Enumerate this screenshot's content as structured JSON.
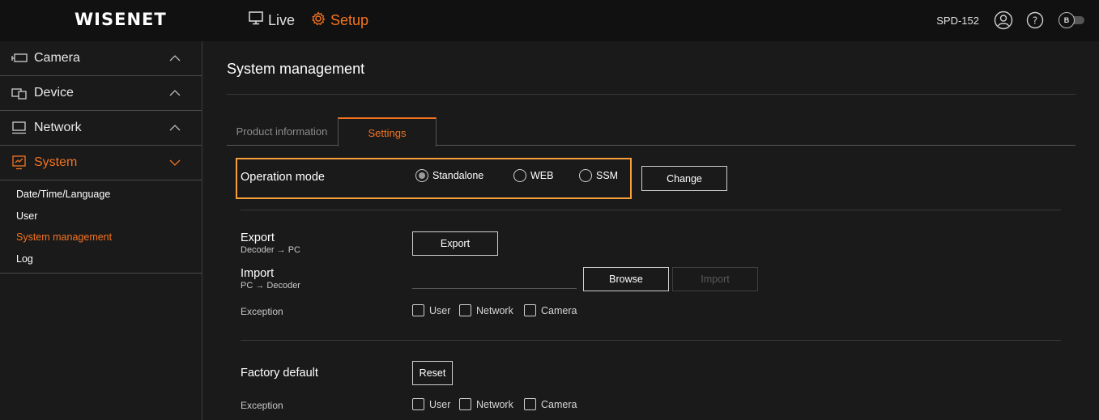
{
  "header": {
    "logo": "WISENET",
    "nav_live": "Live",
    "nav_setup": "Setup",
    "device_name": "SPD-152",
    "toggle_label": "B"
  },
  "sidebar": {
    "menus": [
      {
        "label": "Camera",
        "icon": "camera-icon",
        "expanded": false
      },
      {
        "label": "Device",
        "icon": "device-icon",
        "expanded": false
      },
      {
        "label": "Network",
        "icon": "network-icon",
        "expanded": false
      },
      {
        "label": "System",
        "icon": "system-icon",
        "expanded": true
      }
    ],
    "system_items": [
      "Date/Time/Language",
      "User",
      "System management",
      "Log"
    ],
    "active_item": "System management"
  },
  "main": {
    "title": "System management",
    "tabs": [
      {
        "label": "Product information",
        "active": false
      },
      {
        "label": "Settings",
        "active": true
      }
    ],
    "operation_mode": {
      "label": "Operation mode",
      "options": [
        "Standalone",
        "WEB",
        "SSM"
      ],
      "selected": "Standalone",
      "change_button": "Change"
    },
    "export": {
      "label": "Export",
      "sub": "Decoder → PC",
      "button": "Export"
    },
    "import": {
      "label": "Import",
      "sub": "PC → Decoder",
      "browse_button": "Browse",
      "import_button": "Import",
      "file_value": ""
    },
    "exception1": {
      "label": "Exception",
      "options": [
        "User",
        "Network",
        "Camera"
      ]
    },
    "factory": {
      "label": "Factory default",
      "button": "Reset"
    },
    "exception2": {
      "label": "Exception",
      "options": [
        "User",
        "Network",
        "Camera"
      ]
    }
  },
  "colors": {
    "accent": "#f37321",
    "highlight_border": "#f7a03c",
    "background": "#1a1a1a",
    "header_bg": "#111111"
  }
}
